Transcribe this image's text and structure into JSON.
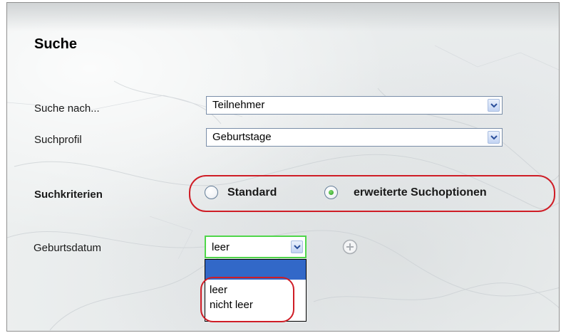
{
  "page": {
    "title": "Suche"
  },
  "form": {
    "search_for": {
      "label": "Suche nach...",
      "value": "Teilnehmer"
    },
    "search_profile": {
      "label": "Suchprofil",
      "value": "Geburtstage"
    },
    "criteria": {
      "label": "Suchkriterien",
      "options": [
        {
          "label": "Standard",
          "selected": false
        },
        {
          "label": "erweiterte Suchoptionen",
          "selected": true
        }
      ]
    },
    "birthdate": {
      "label": "Geburtsdatum",
      "value": "leer",
      "dropdown_options": [
        "",
        "leer",
        "nicht leer"
      ],
      "highlighted_index": 0,
      "add_icon": "plus-circle-icon"
    }
  },
  "colors": {
    "highlight_annotation": "#cf1d26",
    "dropdown_selection": "#3268c8",
    "select_focus_border": "#4fd64a",
    "radio_checked": "#2a9a21"
  }
}
